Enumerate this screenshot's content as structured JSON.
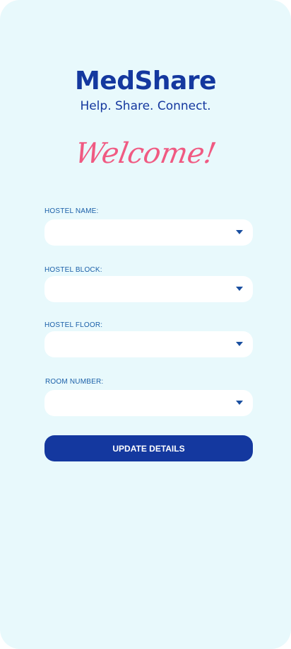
{
  "app": {
    "brand": "MedShare",
    "tagline": "Help. Share. Connect.",
    "welcome": "Welcome!"
  },
  "form": {
    "fields": [
      {
        "label": "HOSTEL NAME:",
        "value": ""
      },
      {
        "label": "HOSTEL BLOCK:",
        "value": ""
      },
      {
        "label": "HOSTEL FLOOR:",
        "value": ""
      },
      {
        "label": "ROOM NUMBER:",
        "value": ""
      }
    ],
    "submit_label": "UPDATE DETAILS"
  },
  "colors": {
    "background": "#e8f9fc",
    "primary": "#14389f",
    "accent": "#f05a82",
    "label": "#1a5fa8"
  }
}
